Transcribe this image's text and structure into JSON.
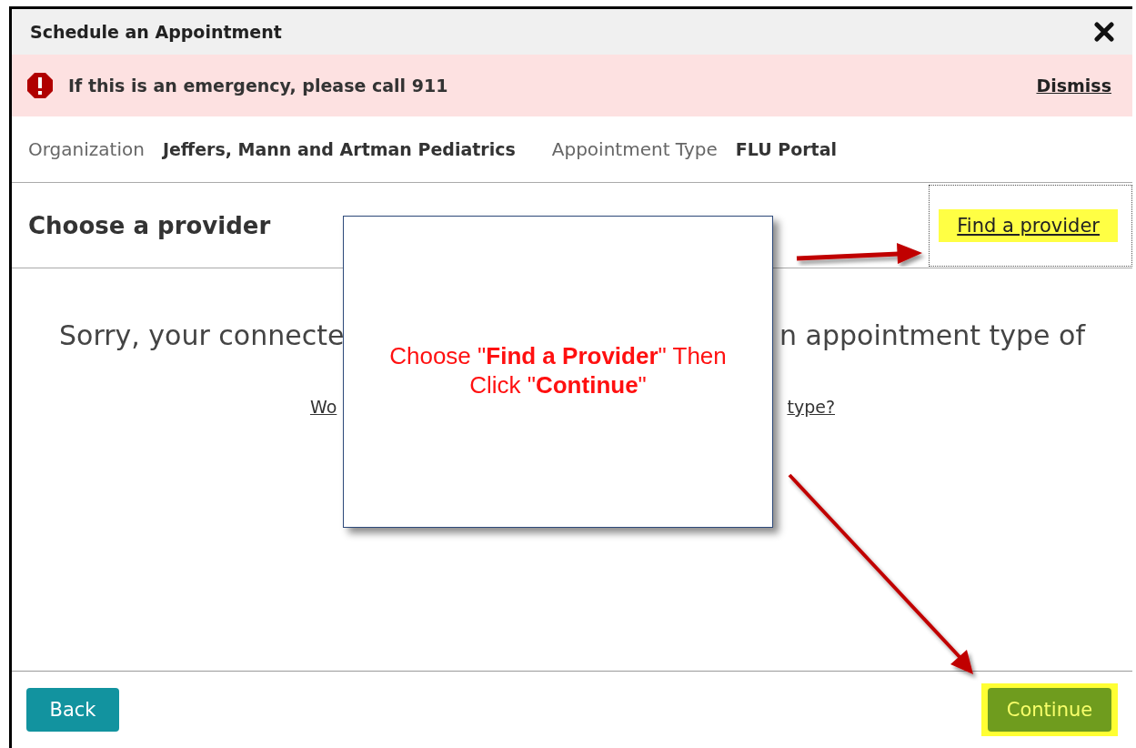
{
  "dialog": {
    "title": "Schedule an Appointment"
  },
  "alert": {
    "message": "If this is an emergency, please call 911",
    "dismiss": "Dismiss"
  },
  "details": [
    {
      "label": "Organization",
      "value": "Jeffers, Mann and Artman Pediatrics"
    },
    {
      "label": "Appointment Type",
      "value": "FLU Portal"
    }
  ],
  "section": {
    "title": "Choose a provider",
    "link": "Find a provider"
  },
  "message": {
    "left": "Sorry, your connecte",
    "right": "n appointment type of",
    "link_left": "Wo",
    "link_right": "type?"
  },
  "footer": {
    "back": "Back",
    "continue": "Continue"
  },
  "annotation": {
    "text": "Choose \"**Find a Provider**\" Then Click \"**Continue**\""
  }
}
